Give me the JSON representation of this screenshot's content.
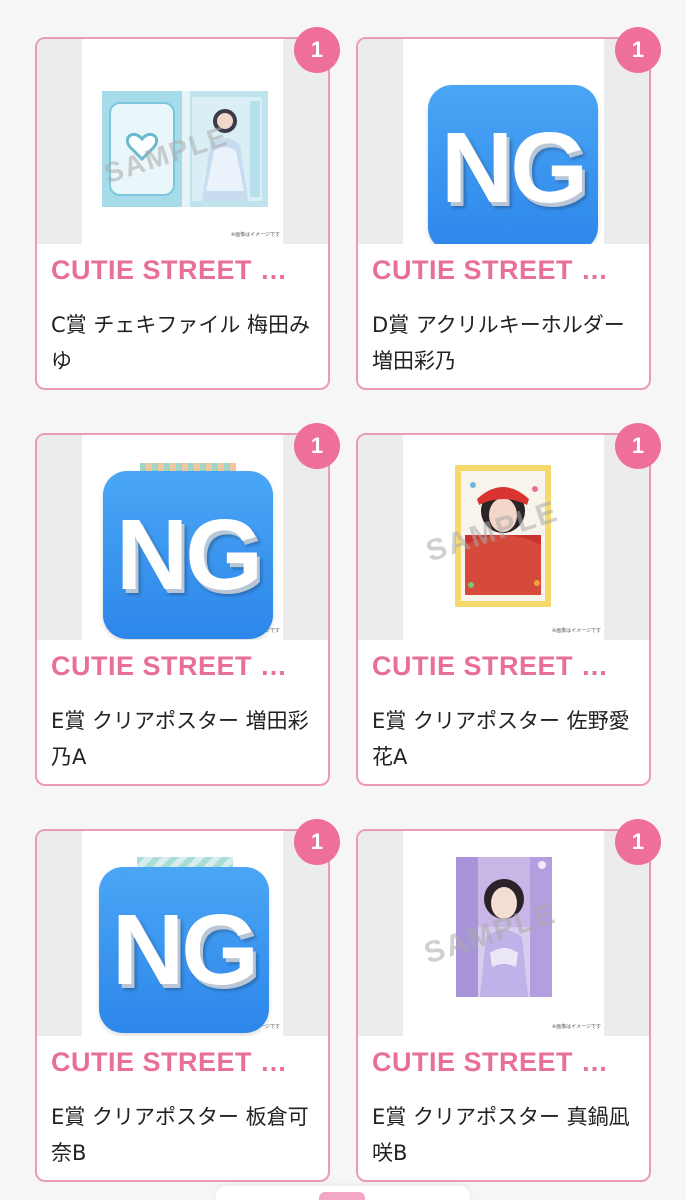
{
  "items": [
    {
      "badge": "1",
      "series": "CUTIE STREET …",
      "title": "C賞 チェキファイル 梅田みゆ",
      "image": "product",
      "sample": "SAMPLE",
      "caption": "※画像はイメージです",
      "brand": "CUTIE STREET"
    },
    {
      "badge": "1",
      "series": "CUTIE STREET …",
      "title": "D賞 アクリルキーホルダー 増田彩乃",
      "image": "ng",
      "ng_text": "NG"
    },
    {
      "badge": "1",
      "series": "CUTIE STREET …",
      "title": "E賞 クリアポスター 増田彩乃A",
      "image": "ng",
      "ng_text": "NG",
      "caption": "※画像はイメージです"
    },
    {
      "badge": "1",
      "series": "CUTIE STREET …",
      "title": "E賞 クリアポスター 佐野愛花A",
      "image": "product",
      "sample": "SAMPLE",
      "caption": "※画像はイメージです"
    },
    {
      "badge": "1",
      "series": "CUTIE STREET …",
      "title": "E賞 クリアポスター 板倉可奈B",
      "image": "ng",
      "ng_text": "NG",
      "caption": "※画像はイメージです"
    },
    {
      "badge": "1",
      "series": "CUTIE STREET …",
      "title": "E賞 クリアポスター 真鍋凪咲B",
      "image": "product",
      "sample": "SAMPLE",
      "caption": "※画像はイメージです"
    }
  ],
  "colors": {
    "accent": "#e86f9a",
    "badge": "#ee6f9a",
    "card_border": "#ea9bb6",
    "ng_blue": "#2d86ea"
  }
}
